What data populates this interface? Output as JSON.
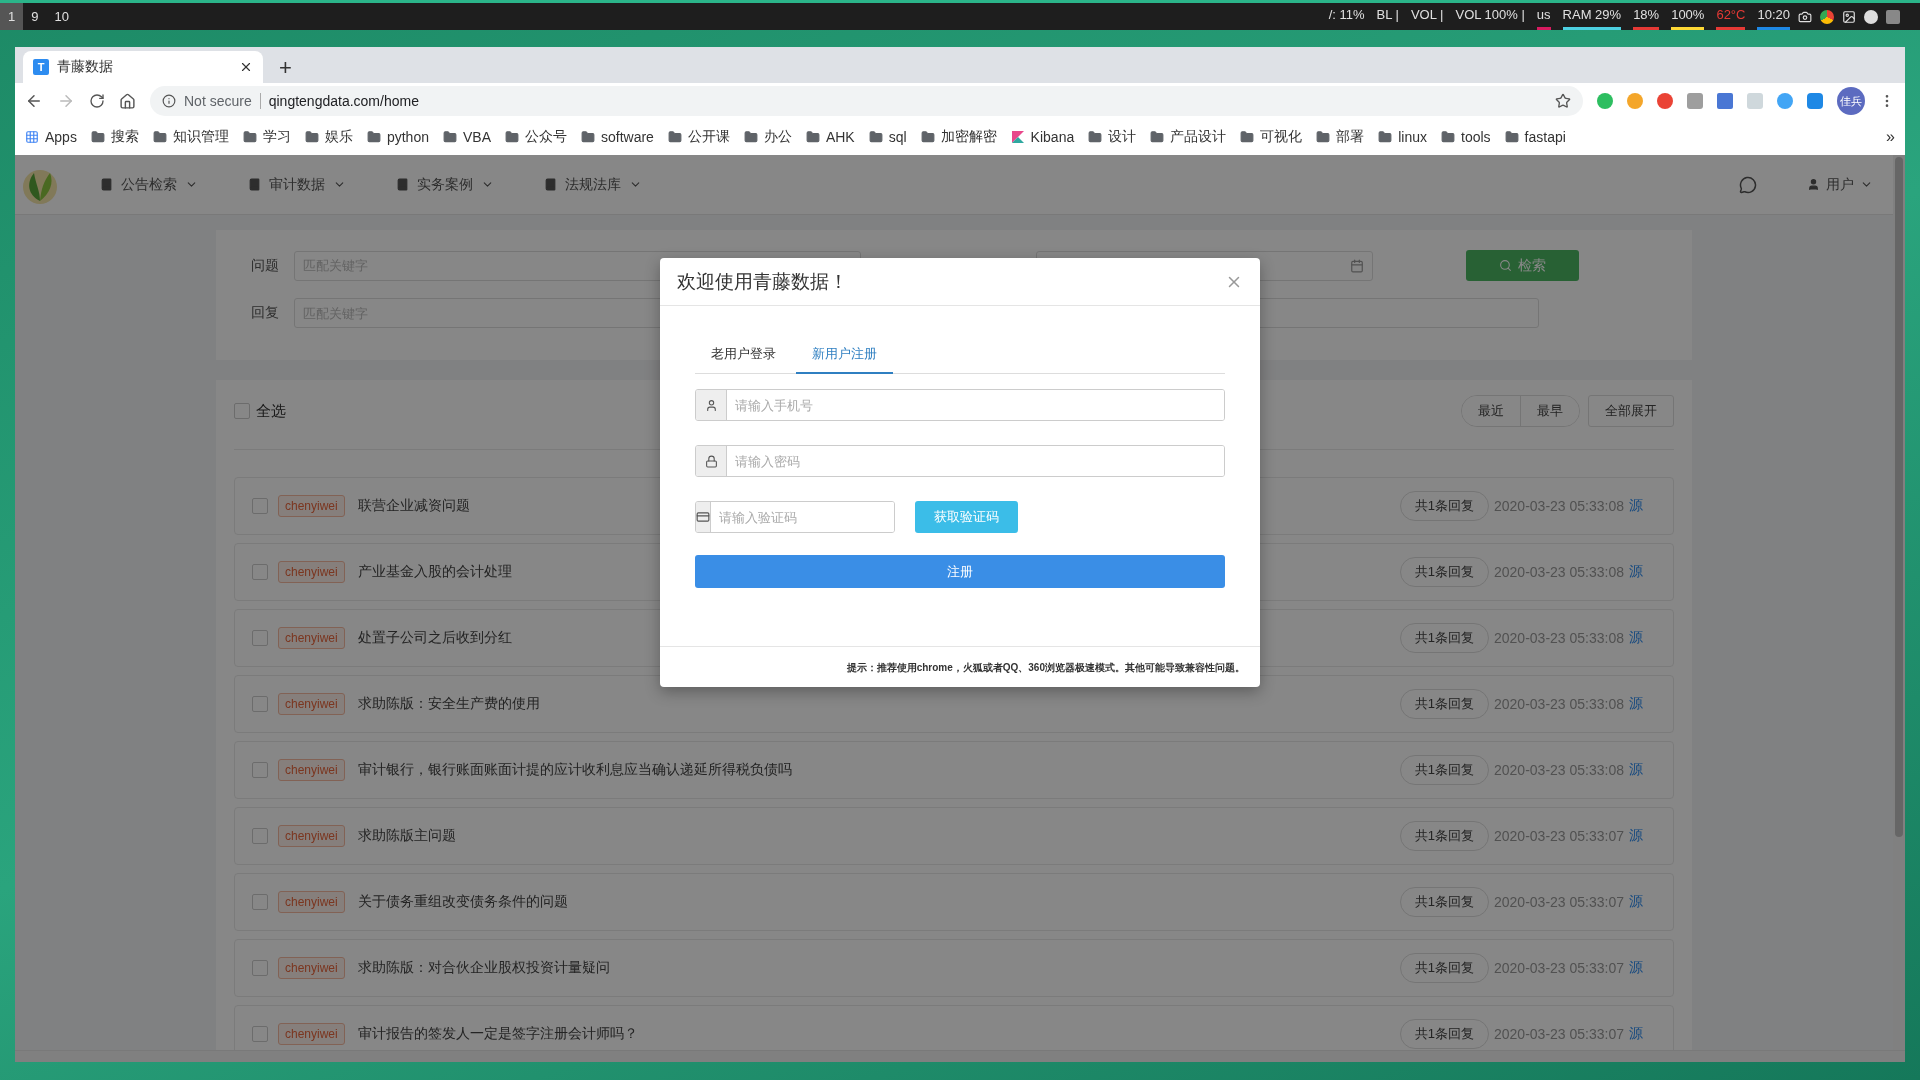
{
  "system_bar": {
    "workspaces": [
      {
        "label": "1",
        "selected": true
      },
      {
        "label": "9",
        "selected": false
      },
      {
        "label": "10",
        "selected": false
      }
    ],
    "status": [
      {
        "text": "/: 11%"
      },
      {
        "text": "BL |"
      },
      {
        "text": "VOL |"
      },
      {
        "text": "VOL 100% |"
      },
      {
        "text": "us",
        "color": "#d81b60"
      },
      {
        "text": "RAM 29%",
        "color": "#4dd0e1"
      },
      {
        "text": "18%",
        "color": "#e53935"
      },
      {
        "text": "100%",
        "color": "#fdd835"
      },
      {
        "text": "62°C",
        "color": "#e53935",
        "warning": true
      },
      {
        "text": "10:20",
        "color": "#1e88e5"
      }
    ]
  },
  "browser": {
    "tab": {
      "title": "青藤数据",
      "favicon": "T"
    },
    "new_tab": "+",
    "security": "Not secure",
    "url": "qingtengdata.com/home",
    "avatar": "佳兵",
    "bookmarks": [
      {
        "label": "Apps",
        "kind": "apps"
      },
      {
        "label": "搜索",
        "kind": "folder"
      },
      {
        "label": "知识管理",
        "kind": "folder"
      },
      {
        "label": "学习",
        "kind": "folder"
      },
      {
        "label": "娱乐",
        "kind": "folder"
      },
      {
        "label": "python",
        "kind": "folder"
      },
      {
        "label": "VBA",
        "kind": "folder"
      },
      {
        "label": "公众号",
        "kind": "folder"
      },
      {
        "label": "software",
        "kind": "folder"
      },
      {
        "label": "公开课",
        "kind": "folder"
      },
      {
        "label": "办公",
        "kind": "folder"
      },
      {
        "label": "AHK",
        "kind": "folder"
      },
      {
        "label": "sql",
        "kind": "folder"
      },
      {
        "label": "加密解密",
        "kind": "folder"
      },
      {
        "label": "Kibana",
        "kind": "site"
      },
      {
        "label": "设计",
        "kind": "folder"
      },
      {
        "label": "产品设计",
        "kind": "folder"
      },
      {
        "label": "可视化",
        "kind": "folder"
      },
      {
        "label": "部署",
        "kind": "folder"
      },
      {
        "label": "linux",
        "kind": "folder"
      },
      {
        "label": "tools",
        "kind": "folder"
      },
      {
        "label": "fastapi",
        "kind": "folder"
      }
    ],
    "more": "»"
  },
  "nav": {
    "items": [
      "公告检索",
      "审计数据",
      "实务案例",
      "法规法库"
    ],
    "user": "用户"
  },
  "search": {
    "fields": [
      {
        "label": "问题",
        "placeholder": "匹配关键字"
      },
      {
        "label": "回复",
        "placeholder": "匹配关键字"
      }
    ],
    "button": "检索"
  },
  "list": {
    "select_all": {
      "label": "全选",
      "checked": false
    },
    "sort": [
      "最近",
      "最早"
    ],
    "expand": "全部展开",
    "rows": [
      {
        "checked": false,
        "author": "chenyiwei",
        "title": "联营企业减资问题",
        "replies": "共1条回复",
        "time": "2020-03-23 05:33:08",
        "source": "源"
      },
      {
        "checked": false,
        "author": "chenyiwei",
        "title": "产业基金入股的会计处理",
        "replies": "共1条回复",
        "time": "2020-03-23 05:33:08",
        "source": "源"
      },
      {
        "checked": false,
        "author": "chenyiwei",
        "title": "处置子公司之后收到分红",
        "replies": "共1条回复",
        "time": "2020-03-23 05:33:08",
        "source": "源"
      },
      {
        "checked": false,
        "author": "chenyiwei",
        "title": "求助陈版：安全生产费的使用",
        "replies": "共1条回复",
        "time": "2020-03-23 05:33:08",
        "source": "源"
      },
      {
        "checked": false,
        "author": "chenyiwei",
        "title": "审计银行，银行账面账面计提的应计收利息应当确认递延所得税负债吗",
        "replies": "共1条回复",
        "time": "2020-03-23 05:33:08",
        "source": "源"
      },
      {
        "checked": false,
        "author": "chenyiwei",
        "title": "求助陈版主问题",
        "replies": "共1条回复",
        "time": "2020-03-23 05:33:07",
        "source": "源"
      },
      {
        "checked": false,
        "author": "chenyiwei",
        "title": "关于债务重组改变债务条件的问题",
        "replies": "共1条回复",
        "time": "2020-03-23 05:33:07",
        "source": "源"
      },
      {
        "checked": false,
        "author": "chenyiwei",
        "title": "求助陈版：对合伙企业股权投资计量疑问",
        "replies": "共1条回复",
        "time": "2020-03-23 05:33:07",
        "source": "源"
      },
      {
        "checked": false,
        "author": "chenyiwei",
        "title": "审计报告的签发人一定是签字注册会计师吗？",
        "replies": "共1条回复",
        "time": "2020-03-23 05:33:07",
        "source": "源"
      }
    ]
  },
  "modal": {
    "title": "欢迎使用青藤数据！",
    "tabs": [
      {
        "label": "老用户登录",
        "selected": false
      },
      {
        "label": "新用户注册",
        "selected": true
      }
    ],
    "fields": [
      {
        "kind": "phone",
        "placeholder": "请输入手机号"
      },
      {
        "kind": "password",
        "placeholder": "请输入密码"
      },
      {
        "kind": "code",
        "placeholder": "请输入验证码"
      }
    ],
    "code_button": "获取验证码",
    "submit": "注册",
    "hint": "提示：推荐使用chrome，火狐或者QQ、360浏览器极速模式。其他可能导致兼容性问题。"
  }
}
